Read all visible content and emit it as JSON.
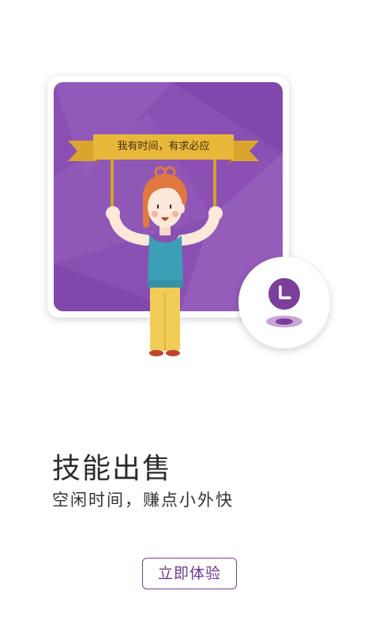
{
  "onboarding": {
    "banner_text": "我有时间，有求必应",
    "title": "技能出售",
    "subtitle": "空闲时间，赚点小外快",
    "cta_label": "立即体验"
  },
  "colors": {
    "card_purple": "#8a4fb3",
    "banner_gold": "#e2b236",
    "accent_purple": "#7b3f9b"
  },
  "icons": {
    "badge_icon": "clock-icon"
  }
}
